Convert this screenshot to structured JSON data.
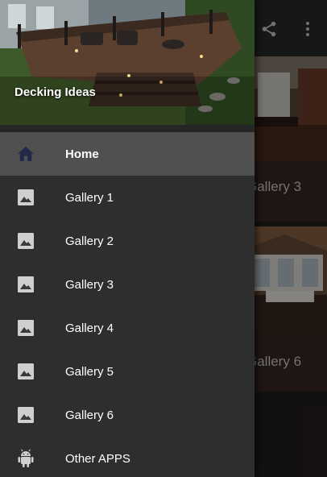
{
  "app": {
    "actions": {
      "share_icon": "share-icon",
      "more_icon": "overflow-menu-icon"
    },
    "cards": [
      {
        "caption": "Gallery 3"
      },
      {
        "caption": "Gallery 6"
      }
    ]
  },
  "drawer": {
    "title": "Decking Ideas",
    "items": [
      {
        "label": "Home",
        "icon": "home-icon",
        "active": true
      },
      {
        "label": "Gallery 1",
        "icon": "image-icon"
      },
      {
        "label": "Gallery 2",
        "icon": "image-icon"
      },
      {
        "label": "Gallery 3",
        "icon": "image-icon"
      },
      {
        "label": "Gallery 4",
        "icon": "image-icon"
      },
      {
        "label": "Gallery 5",
        "icon": "image-icon"
      },
      {
        "label": "Gallery 6",
        "icon": "image-icon"
      },
      {
        "label": "Other APPS",
        "icon": "android-icon"
      }
    ]
  },
  "colors": {
    "drawer_bg": "#2e2e2e",
    "active_item_bg": "#505050",
    "home_icon": "#1f2a4a",
    "image_icon": "#cfcfcf"
  }
}
